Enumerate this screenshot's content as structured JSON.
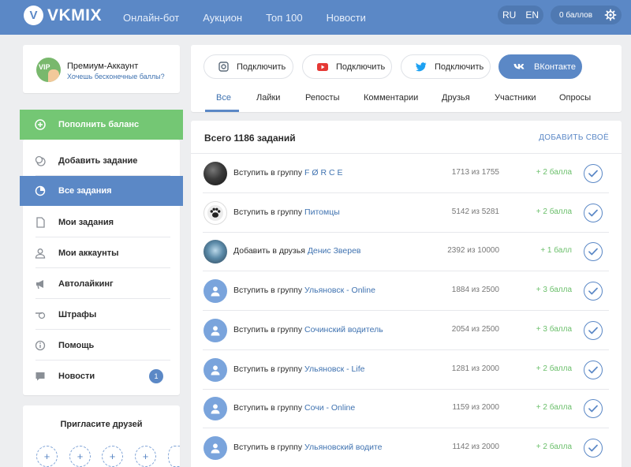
{
  "header": {
    "logo_letter": "V",
    "logo_text": "VKMIX",
    "nav": [
      "Онлайн-бот",
      "Аукцион",
      "Топ 100",
      "Новости"
    ],
    "lang": [
      "RU",
      "EN"
    ],
    "balance": "0 баллов",
    "accent": "#5b88c6"
  },
  "premium": {
    "badge": "VIP",
    "title": "Премиум-Аккаунт",
    "subtitle": "Хочешь бесконечные баллы?"
  },
  "sidebar": {
    "topup": "Пополнить баланс",
    "items": [
      {
        "label": "Добавить задание",
        "icon": "coins-icon"
      },
      {
        "label": "Все задания",
        "icon": "pie-chart-icon"
      },
      {
        "label": "Мои задания",
        "icon": "document-icon"
      },
      {
        "label": "Мои аккаунты",
        "icon": "user-icon"
      },
      {
        "label": "Автолайкинг",
        "icon": "megaphone-icon"
      },
      {
        "label": "Штрафы",
        "icon": "whistle-icon"
      },
      {
        "label": "Помощь",
        "icon": "info-icon"
      },
      {
        "label": "Новости",
        "icon": "chat-icon"
      }
    ],
    "news_badge": "1"
  },
  "invite": {
    "title": "Пригласите друзей",
    "plus": "+"
  },
  "social": {
    "buttons": [
      {
        "label": "Подключить",
        "icon": "instagram-icon"
      },
      {
        "label": "Подключить",
        "icon": "youtube-icon"
      },
      {
        "label": "Подключить",
        "icon": "twitter-icon"
      },
      {
        "label": "ВКонтакте",
        "icon": "vk-icon"
      }
    ],
    "tabs": [
      "Все",
      "Лайки",
      "Репосты",
      "Комментарии",
      "Друзья",
      "Участники",
      "Опросы"
    ]
  },
  "tasks": {
    "title": "Всего 1186 заданий",
    "add": "ДОБАВИТЬ СВОЁ",
    "rows": [
      {
        "action": "Вступить в группу",
        "target": "F Ø R C E",
        "count": "1713 из 1755",
        "points": "+ 2 балла",
        "avatar": "dark"
      },
      {
        "action": "Вступить в группу",
        "target": "Питомцы",
        "count": "5142 из 5281",
        "points": "+ 2 балла",
        "avatar": "paw"
      },
      {
        "action": "Добавить в друзья",
        "target": "Денис Зверев",
        "count": "2392 из 10000",
        "points": "+ 1 балл",
        "avatar": "photo"
      },
      {
        "action": "Вступить в группу",
        "target": "Ульяновск - Online",
        "count": "1884 из 2500",
        "points": "+ 3 балла",
        "avatar": "default"
      },
      {
        "action": "Вступить в группу",
        "target": "Сочинский водитель",
        "count": "2054 из 2500",
        "points": "+ 3 балла",
        "avatar": "default"
      },
      {
        "action": "Вступить в группу",
        "target": "Ульяновск - Life",
        "count": "1281 из 2000",
        "points": "+ 2 балла",
        "avatar": "default"
      },
      {
        "action": "Вступить в группу",
        "target": "Сочи - Online",
        "count": "1159 из 2000",
        "points": "+ 2 балла",
        "avatar": "default"
      },
      {
        "action": "Вступить в группу",
        "target": "Ульяновский водите",
        "count": "1142 из 2000",
        "points": "+ 2 балла",
        "avatar": "default"
      }
    ]
  }
}
